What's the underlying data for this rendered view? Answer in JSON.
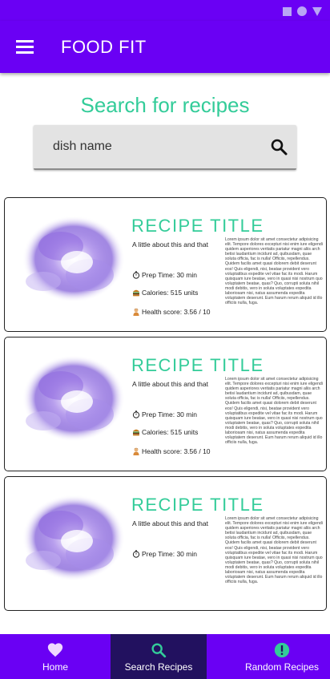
{
  "app": {
    "title": "FOOD FIT"
  },
  "colors": {
    "primary": "#6a00f4",
    "accent": "#33cc99",
    "nav_active": "#22115f"
  },
  "search": {
    "heading": "Search for recipes",
    "placeholder": "dish name",
    "icon": "search-icon"
  },
  "recipes": [
    {
      "title": "RECIPE TITLE",
      "subtitle": "A little about this and that",
      "prep": "Prep Time: 30 min",
      "calories": "Calories: 515 units",
      "health": "Health score: 3.56 / 10",
      "description": "Lorem ipsum dolor sit amet consectetur adipisicing elit. Tempore dolores excepturi nisi enim iure eligendi quidem asperiores veritatis pariatur magni aliis arch betisi laudantium incidunt ad, quibusdam, quae soluta officia, fac is nulla! Officiis, repellendus. Quidem facilis amet quasi dolorem debit deserunt eos! Quis eligendi, nisi, beatae provident vero voluptatibus expedite vel vitae fac its modi. Harum quisquam iure beatae, vero in quasi nisi nostrum quo voluptatem beatae, quas? Quo, corrupti soluta nihil modi debitis, vero in soluta voluptates expedita laboriosam nisi, natus assumenda expedita voluptatem deserunt. Eum harum rerum aliquid id illo officiis nulla, fuga."
    },
    {
      "title": "RECIPE TITLE",
      "subtitle": "A little about this and that",
      "prep": "Prep Time: 30 min",
      "calories": "Calories: 515 units",
      "health": "Health score: 3.56 / 10",
      "description": "Lorem ipsum dolor sit amet consectetur adipisicing elit. Tempore dolores excepturi nisi enim iure eligendi quidem asperiores veritatis pariatur magni aliis arch betisi laudantium incidunt ad, quibusdam, quae soluta officia, fac is nulla! Officiis, repellendus. Quidem facilis amet quasi dolorem debit deserunt eos! Quis eligendi, nisi, beatae provident vero voluptatibus expedite vel vitae fac its modi. Harum quisquam iure beatae, vero in quasi nisi nostrum quo voluptatem beatae, quas? Quo, corrupti soluta nihil modi debitis, vero in soluta voluptates expedita laboriosam nisi, natus assumenda expedita voluptatem deserunt. Eum harum rerum aliquid id illo officiis nulla, fuga."
    },
    {
      "title": "RECIPE TITLE",
      "subtitle": "A little about this and that",
      "prep": "Prep Time: 30 min",
      "description": "Lorem ipsum dolor sit amet consectetur adipisicing elit. Tempore dolores excepturi nisi enim iure eligendi quidem asperiores veritatis pariatur magni aliis arch betisi laudantium incidunt ad, quibusdam, quae soluta officia, fac is nulla! Officiis, repellendus. Quidem facilis amet quasi dolorem debit deserunt eos! Quis eligendi, nisi, beatae provident vero voluptatibus expedite vel vitae fac its modi. Harum quisquam iure beatae, vero in quasi nisi nostrum quo voluptatem beatae, quas? Quo, corrupti soluta nihil modi debitis, vero in soluta voluptates expedita laboriosam nisi, natus assumenda expedita voluptatem deserunt. Eum harum rerum aliquid id illo officiis nulla, fuga."
    }
  ],
  "bottom_nav": [
    {
      "label": "Home",
      "icon": "heart-icon",
      "active": false
    },
    {
      "label": "Search Recipes",
      "icon": "search-icon",
      "active": true
    },
    {
      "label": "Random Recipes",
      "icon": "alert-circle-icon",
      "active": false
    }
  ]
}
